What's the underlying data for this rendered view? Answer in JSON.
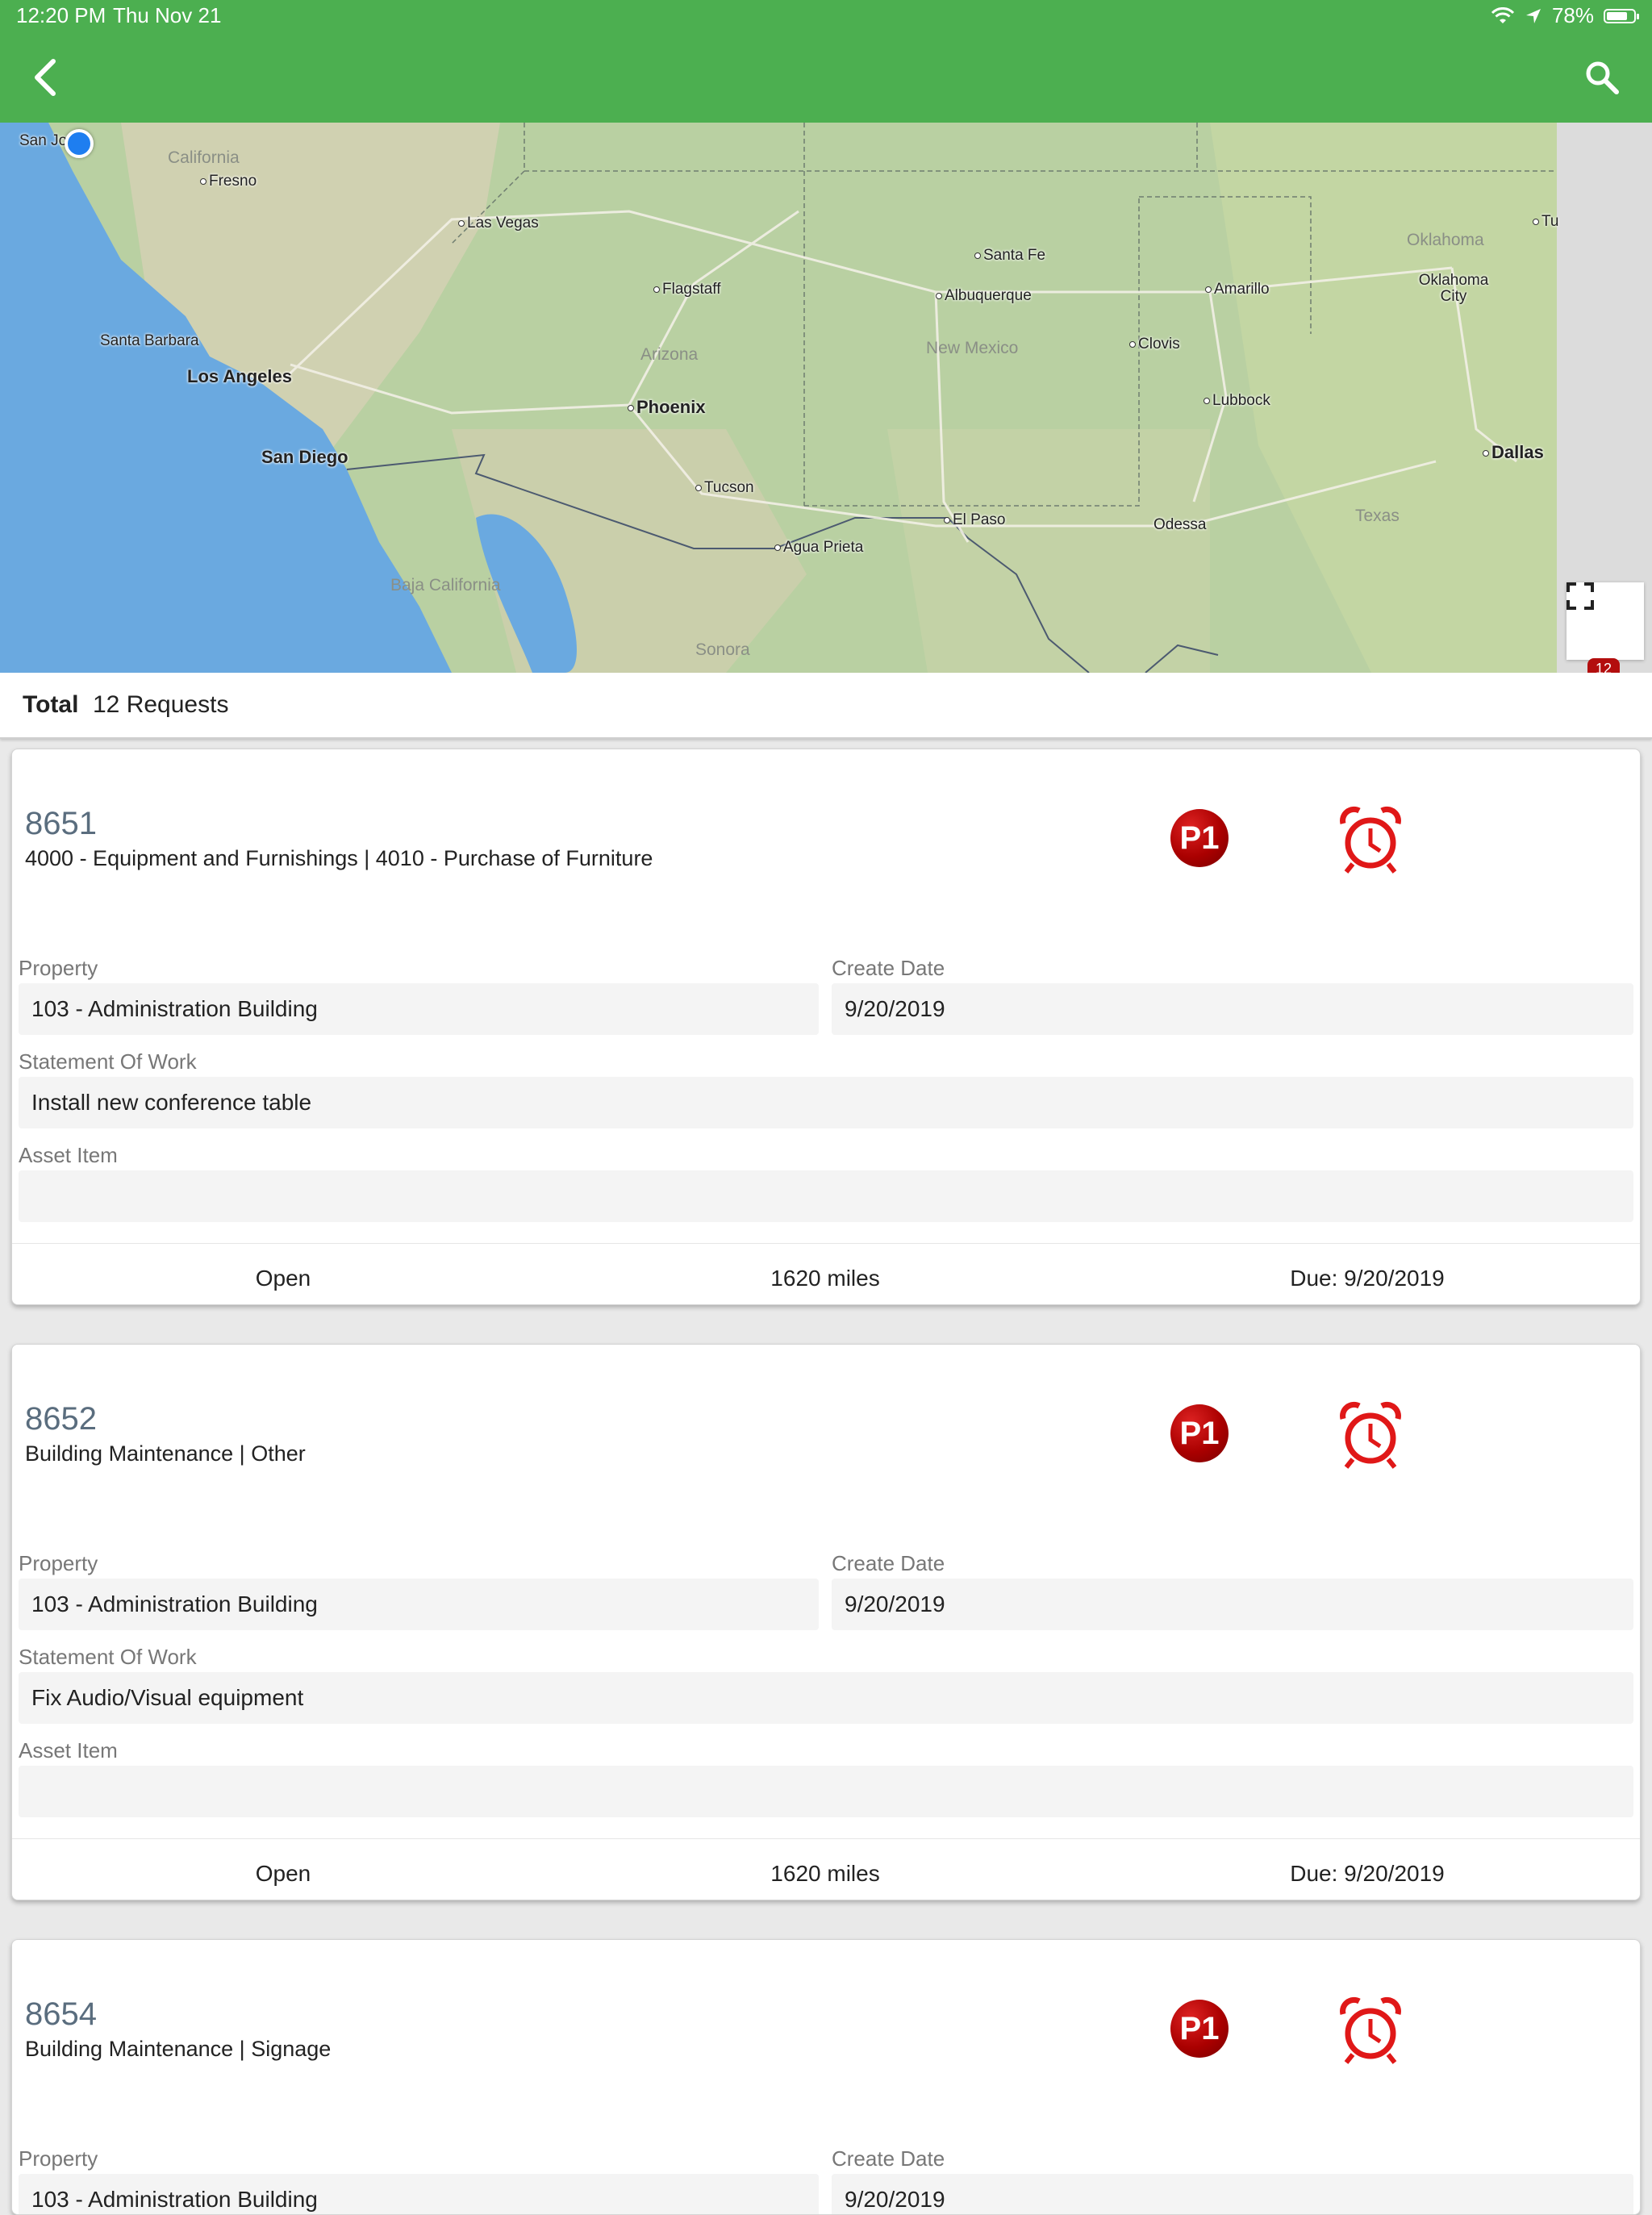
{
  "status_bar": {
    "time": "12:20 PM",
    "date": "Thu Nov 21",
    "battery": "78%",
    "battery_level": 0.78
  },
  "header": {
    "back_icon": "chevron-left-icon",
    "search_icon": "search-icon",
    "color": "#4caf50"
  },
  "map": {
    "labels": {
      "san_jose": "San Jo",
      "california": "California",
      "fresno": "Fresno",
      "las_vegas": "Las Vegas",
      "santa_fe": "Santa Fe",
      "flagstaff": "Flagstaff",
      "albuquerque": "Albuquerque",
      "amarillo": "Amarillo",
      "oklahoma": "Oklahoma",
      "oklahoma_city": "Oklahoma City",
      "tu": "Tu",
      "santa_barbara": "Santa Barbara",
      "los_angeles": "Los Angeles",
      "arizona": "Arizona",
      "new_mexico": "New Mexico",
      "clovis": "Clovis",
      "phoenix": "Phoenix",
      "lubbock": "Lubbock",
      "san_diego": "San Diego",
      "dallas": "Dallas",
      "tucson": "Tucson",
      "el_paso": "El Paso",
      "odessa": "Odessa",
      "texas": "Texas",
      "agua_prieta": "Agua Prieta",
      "baja_california": "Baja California",
      "sonora": "Sonora"
    },
    "cluster_count": "12"
  },
  "total": {
    "label": "Total",
    "value": "12 Requests"
  },
  "requests": [
    {
      "id": "8651",
      "category": "4000 - Equipment and Furnishings | 4010 - Purchase of Furniture",
      "priority": "P1",
      "property_label": "Property",
      "property": "103 - Administration Building",
      "create_date_label": "Create Date",
      "create_date": "9/20/2019",
      "sow_label": "Statement Of Work",
      "sow": "Install new conference table",
      "asset_label": "Asset Item",
      "asset": "",
      "status": "Open",
      "distance": "1620 miles",
      "due": "Due: 9/20/2019"
    },
    {
      "id": "8652",
      "category": "Building Maintenance | Other",
      "priority": "P1",
      "property_label": "Property",
      "property": "103 - Administration Building",
      "create_date_label": "Create Date",
      "create_date": "9/20/2019",
      "sow_label": "Statement Of Work",
      "sow": "Fix Audio/Visual equipment",
      "asset_label": "Asset Item",
      "asset": "",
      "status": "Open",
      "distance": "1620 miles",
      "due": "Due: 9/20/2019"
    },
    {
      "id": "8654",
      "category": "Building Maintenance | Signage",
      "priority": "P1",
      "property_label": "Property",
      "property": "103 - Administration Building",
      "create_date_label": "Create Date",
      "create_date": "9/20/2019"
    }
  ]
}
